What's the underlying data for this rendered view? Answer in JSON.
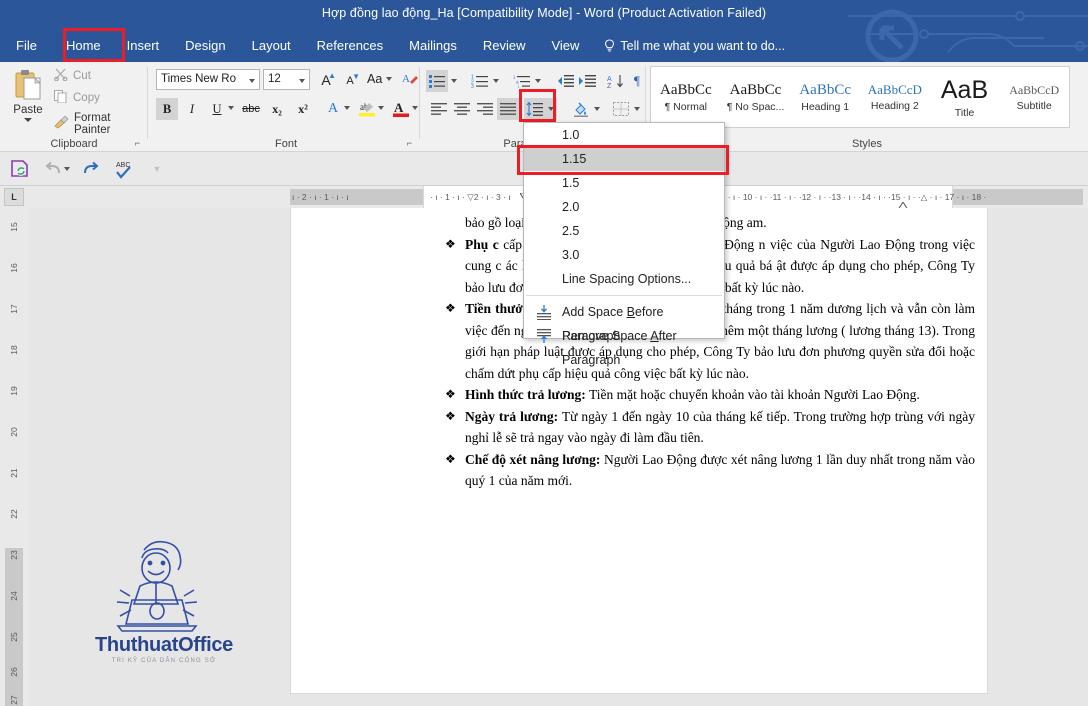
{
  "titlebar": {
    "document_title": "Hợp đồng lao động_Ha [Compatibility Mode] - Word (Product Activation Failed)",
    "tabs": [
      {
        "label": "File"
      },
      {
        "label": "Home"
      },
      {
        "label": "Insert"
      },
      {
        "label": "Design"
      },
      {
        "label": "Layout"
      },
      {
        "label": "References"
      },
      {
        "label": "Mailings"
      },
      {
        "label": "Review"
      },
      {
        "label": "View"
      }
    ],
    "active_tab": "Home",
    "tell_me": "Tell me what you want to do...",
    "accent_color": "#2b579a",
    "highlight_color": "#ee1c25"
  },
  "ribbon": {
    "groups": [
      {
        "name": "Clipboard",
        "label": "Clipboard"
      },
      {
        "name": "Font",
        "label": "Font"
      },
      {
        "name": "Paragraph",
        "label": "Para"
      },
      {
        "name": "Styles",
        "label": "Styles"
      }
    ],
    "clipboard": {
      "paste_label": "Paste",
      "cut_label": "Cut",
      "copy_label": "Copy",
      "format_painter_label": "Format Painter"
    },
    "font": {
      "font_name": "Times New Ro",
      "font_size": "12",
      "grow_font": "A",
      "shrink_font": "A",
      "change_case": "Aa",
      "clear_formatting": "clear-formatting",
      "bold": "B",
      "italic": "I",
      "underline": "U",
      "strikethrough": "abc",
      "subscript": "x₂",
      "superscript": "x²",
      "text_effects": "A",
      "highlight": "ab",
      "font_color": "A"
    },
    "paragraph": {
      "bullets": "bullets-icon",
      "numbering": "numbering-icon",
      "multilevel": "multilevel-list-icon",
      "decrease_indent": "decrease-indent-icon",
      "increase_indent": "increase-indent-icon",
      "sort": "sort-icon",
      "show_marks": "¶",
      "align_left": "align-left-icon",
      "align_center": "align-center-icon",
      "align_right": "align-right-icon",
      "justify": "justify-icon",
      "line_spacing": "line-spacing-icon",
      "shading": "shading-icon",
      "borders": "borders-icon"
    },
    "styles": [
      {
        "preview": "AaBbCc",
        "name": "¶ Normal"
      },
      {
        "preview": "AaBbCc",
        "name": "¶ No Spac..."
      },
      {
        "preview": "AaBbCc",
        "name": "Heading 1"
      },
      {
        "preview": "AaBbCcD",
        "name": "Heading 2"
      },
      {
        "preview": "AaB",
        "name": "Title"
      },
      {
        "preview": "AaBbCcD",
        "name": "Subtitle"
      }
    ]
  },
  "quick_access": {
    "save": "save-icon",
    "undo": "undo-icon",
    "redo": "redo-icon",
    "spelling": "spelling-check-icon",
    "customize": "customize-icon"
  },
  "rulers": {
    "tab_stop_marker": "L",
    "horizontal_left_margin_ticks": "ı · 2 · ı · 1 · ı · ı",
    "horizontal_page_ticks": "·  ı  · 1 · ı · ▽2 ·  ı ·  3 ·  ı",
    "horizontal_right_ticks": "ı · ı · 10 · ı · ·11 · ı · ·12 · ı · ·13 · ı · ·14 · ı · ·15 · ı · ·△ · ı · 17 · ı · 18 ·",
    "vertical_ticks": [
      "15",
      "16",
      "17",
      "18",
      "19",
      "20",
      "21",
      "22",
      "23",
      "24",
      "25",
      "26",
      "27"
    ]
  },
  "dropdown": {
    "name": "line-spacing-dropdown",
    "items": [
      {
        "label": "1.0",
        "selected": false,
        "icon": null
      },
      {
        "label": "1.15",
        "selected": true,
        "icon": null
      },
      {
        "label": "1.5",
        "selected": false,
        "icon": null
      },
      {
        "label": "2.0",
        "selected": false,
        "icon": null
      },
      {
        "label": "2.5",
        "selected": false,
        "icon": null
      },
      {
        "label": "3.0",
        "selected": false,
        "icon": null
      },
      {
        "label": "Line Spacing Options...",
        "selected": false,
        "icon": null
      }
    ],
    "footer_items": [
      {
        "label_pre": "Add Space ",
        "label_key": "B",
        "label_post": "efore Paragraph",
        "icon": "add-space-before-icon"
      },
      {
        "label_pre": "Remove Space ",
        "label_key": "A",
        "label_post": "fter Paragraph",
        "icon": "remove-space-after-icon"
      }
    ]
  },
  "document": {
    "paragraphs": [
      {
        "bullet": "❖",
        "hidden_prefix": true,
        "bold": "",
        "text": "bảo gồ                              loại bảo hiểm bắt buộc mà Người Lao Động                             am."
      },
      {
        "bullet": "❖",
        "bold": "Phụ c",
        "text": "              cấp hiệu quả công việc của Người Lao Động                  n việc của Người Lao Động trong việc cung c                 ác hoạt động nghiên cứu thị trường, hiệu quả bá                 ật được áp dụng cho phép, Công Ty bảo lưu đơ                 hấm dứt phụ cấp hiệu quả công việc bất kỳ lúc nào."
      },
      {
        "bullet": "❖",
        "bold": "Tiền thưởng:",
        "text": " Người lao động làm việc đủ 12 tháng trong 1 năm dương lịch và vẫn còn làm việc đến ngày 31/12 của năm thì được thưởng thêm một tháng lương ( lương tháng 13). Trong giới hạn pháp luật được áp dụng cho phép, Công Ty bảo lưu đơn phương quyền sửa đổi hoặc chấm dứt phụ cấp hiệu quả công việc bất kỳ lúc nào."
      },
      {
        "bullet": "❖",
        "bold": "Hình thức trả lương:",
        "text": " Tiền mặt hoặc chuyển khoản vào tài khoản Người Lao Động."
      },
      {
        "bullet": "❖",
        "bold": "Ngày trả lương:",
        "text": " Từ ngày 1 đến ngày 10 của tháng kế tiếp. Trong trường hợp trùng với ngày nghỉ lễ sẽ trả ngay vào ngày đi làm đầu tiên."
      },
      {
        "bullet": "❖",
        "bold": "Chế độ xét nâng lương:",
        "text": " Người Lao Động được xét nâng lương 1 lần duy nhất trong năm vào quý 1 của năm mới."
      }
    ]
  },
  "watermark": {
    "brand": "ThuthuatOffice",
    "tagline": "TRI KỸ CỦA DÂN CÔNG SỞ",
    "color": "#1f3c88"
  }
}
